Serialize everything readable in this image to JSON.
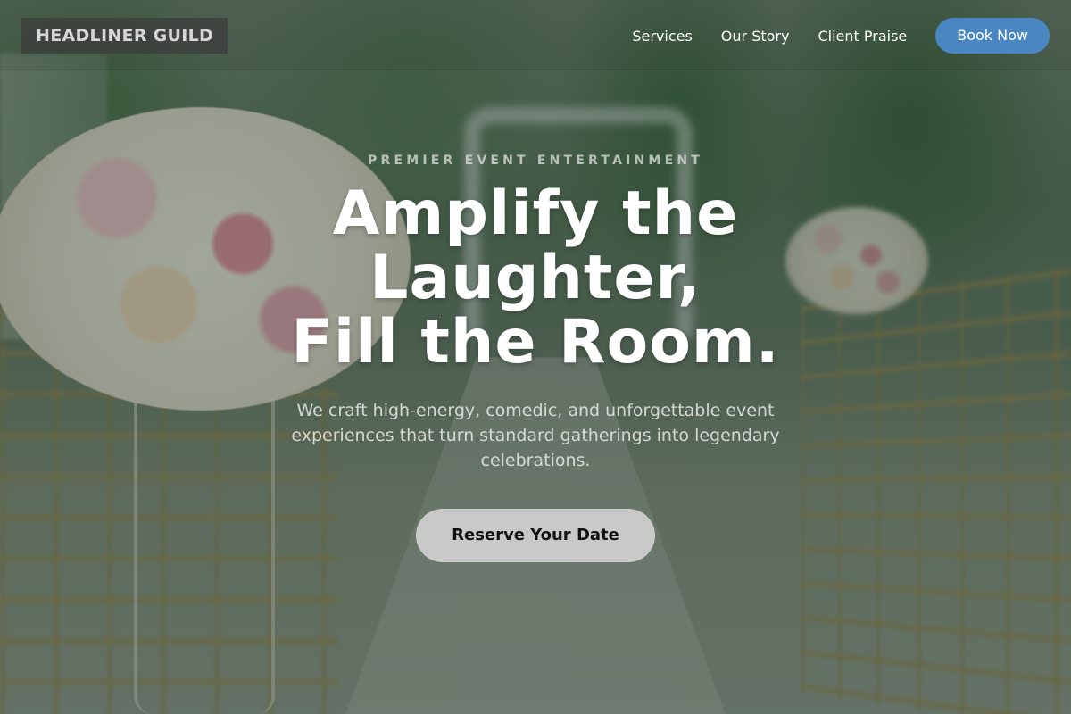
{
  "brand": {
    "name": "HEADLINER GUILD"
  },
  "nav": {
    "links": [
      "Services",
      "Our Story",
      "Client Praise"
    ],
    "cta_label": "Book Now"
  },
  "hero": {
    "eyebrow": "PREMIER EVENT ENTERTAINMENT",
    "headline_lines": [
      "Amplify the",
      "Laughter,",
      "Fill the Room."
    ],
    "subtext": "We craft high-energy, comedic, and unforgettable event experiences that turn standard gatherings into legendary celebrations.",
    "cta_label": "Reserve Your Date"
  },
  "colors": {
    "accent": "#4a86c1",
    "cta_bg": "#c9c9c9",
    "logo_bg": "#3c3c3c"
  },
  "background_image": "blurred-wedding-ceremony-aisle-with-floral-arrangement"
}
